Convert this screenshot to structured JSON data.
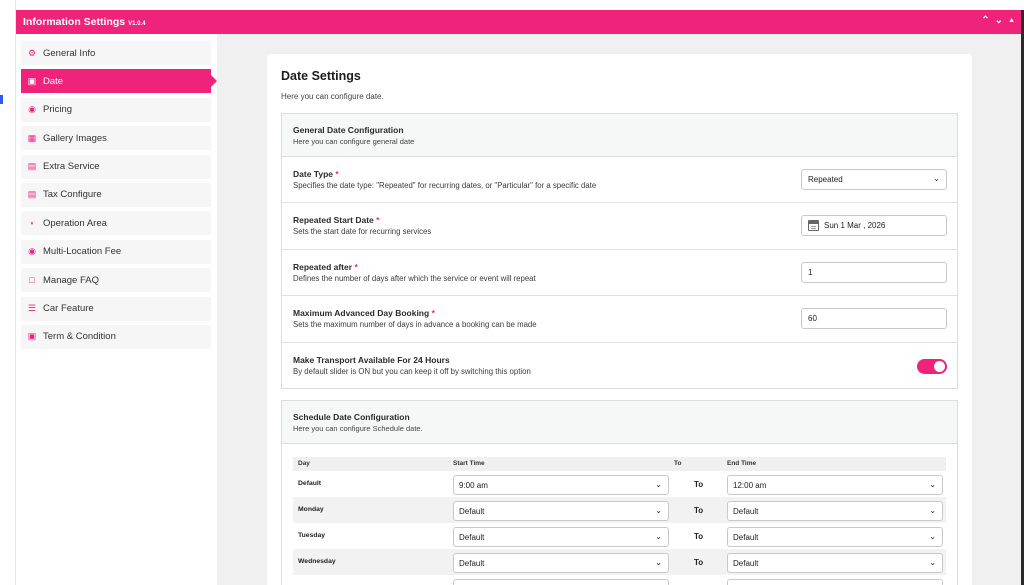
{
  "window": {
    "title": "Information Settings",
    "version": "V1.0.4",
    "controls": [
      "chevron-up",
      "chevron-down",
      "caret-up"
    ]
  },
  "sidebar": {
    "items": [
      {
        "label": "General Info",
        "icon": "gear-icon"
      },
      {
        "label": "Date",
        "icon": "calendar-icon",
        "active": true
      },
      {
        "label": "Pricing",
        "icon": "coins-icon"
      },
      {
        "label": "Gallery Images",
        "icon": "images-icon"
      },
      {
        "label": "Extra Service",
        "icon": "briefcase-icon"
      },
      {
        "label": "Tax Configure",
        "icon": "receipt-icon"
      },
      {
        "label": "Operation Area",
        "icon": "location-icon"
      },
      {
        "label": "Multi-Location Fee",
        "icon": "car-icon"
      },
      {
        "label": "Manage FAQ",
        "icon": "faq-icon"
      },
      {
        "label": "Car Feature",
        "icon": "list-icon"
      },
      {
        "label": "Term & Condition",
        "icon": "document-icon"
      }
    ]
  },
  "main": {
    "title": "Date Settings",
    "subtitle": "Here you can configure date.",
    "general": {
      "heading": "General Date Configuration",
      "description": "Here you can configure general date",
      "date_type": {
        "label": "Date Type",
        "required": "*",
        "description": "Specifies the date type: \"Repeated\" for recurring dates, or \"Particular\" for a specific date",
        "value": "Repeated"
      },
      "start_date": {
        "label": "Repeated Start Date",
        "required": "*",
        "description": "Sets the start date for recurring services",
        "value": "Sun 1 Mar , 2026"
      },
      "repeated_after": {
        "label": "Repeated after",
        "required": "*",
        "description": "Defines the number of days after which the service or event will repeat",
        "value": "1"
      },
      "max_advance": {
        "label": "Maximum Advanced Day Booking",
        "required": "*",
        "description": "Sets the maximum number of days in advance a booking can be made",
        "value": "60"
      },
      "available_24h": {
        "label": "Make Transport Available For 24 Hours",
        "description": "By default slider is ON but you can keep it off by switching this option",
        "on": true
      }
    },
    "schedule": {
      "heading": "Schedule Date Configuration",
      "description": "Here you can configure Schedule date.",
      "columns": {
        "day": "Day",
        "start": "Start Time",
        "to": "To",
        "end": "End Time"
      },
      "rows": [
        {
          "day": "Default",
          "start": "9:00 am",
          "to": "To",
          "end": "12:00 am"
        },
        {
          "day": "Monday",
          "start": "Default",
          "to": "To",
          "end": "Default"
        },
        {
          "day": "Tuesday",
          "start": "Default",
          "to": "To",
          "end": "Default"
        },
        {
          "day": "Wednesday",
          "start": "Default",
          "to": "To",
          "end": "Default"
        }
      ]
    }
  },
  "colors": {
    "accent": "#f0237a",
    "background": "#f0f0f1",
    "panel": "#ffffff"
  }
}
